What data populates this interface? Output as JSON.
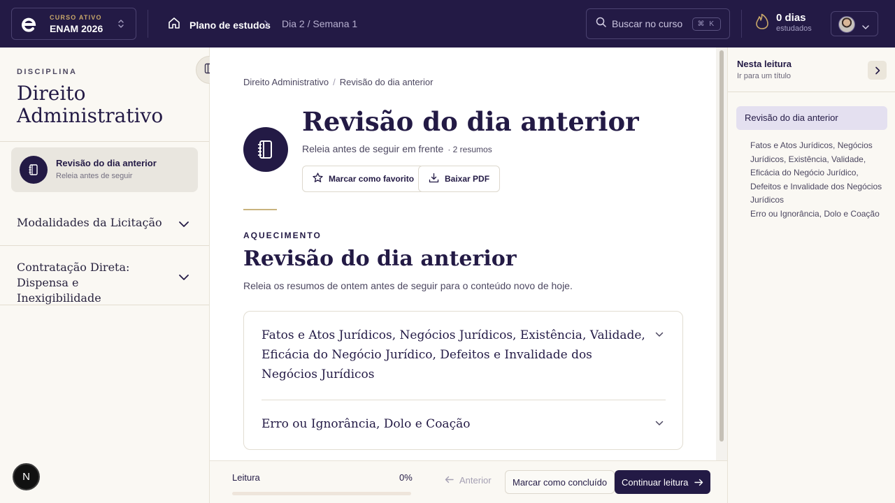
{
  "topbar": {
    "course_kicker": "CURSO ATIVO",
    "course_name": "ENAM 2026",
    "home_label": "Plano de estudos",
    "current_location": "Dia 2 / Semana 1",
    "search_placeholder": "Buscar no curso",
    "search_shortcut": "⌘ K",
    "streak_count": "0 dias",
    "streak_label": "estudados"
  },
  "sidebar": {
    "discipline_kicker": "DISCIPLINA",
    "discipline_title": "Direito Administrativo",
    "active_lesson": {
      "title": "Revisão do dia anterior",
      "subtitle": "Releia antes de seguir"
    },
    "modules": [
      {
        "label": "Modalidades da Licitação"
      },
      {
        "label": "Contratação Direta: Dispensa e Inexigibilidade"
      }
    ],
    "badge_letter": "N"
  },
  "main": {
    "breadcrumb": [
      "Direito Administrativo",
      "Revisão do dia anterior"
    ],
    "title": "Revisão do dia anterior",
    "subtitle": "Releia antes de seguir em frente",
    "summary_count": "· 2 resumos",
    "favorite_label": "Marcar como favorito",
    "pdf_label": "Baixar PDF",
    "section_kicker": "AQUECIMENTO",
    "section_title": "Revisão do dia anterior",
    "section_description": "Releia os resumos de ontem antes de seguir para o conteúdo novo de hoje.",
    "summaries": [
      {
        "title": "Fatos e Atos Jurídicos, Negócios Jurídicos, Existência, Validade, Eficácia do Negócio Jurídico, Defeitos e Invalidade dos Negócios Jurídicos"
      },
      {
        "title": "Erro ou Ignorância, Dolo e Coação"
      }
    ]
  },
  "footer": {
    "reading_label": "Leitura",
    "reading_percent": "0%",
    "reading_progress": 0,
    "previous_label": "Anterior",
    "mark_done_label": "Marcar como concluído",
    "continue_label": "Continuar leitura"
  },
  "toc": {
    "title": "Nesta leitura",
    "subtitle": "Ir para um título",
    "active_item": "Revisão do dia anterior",
    "items": [
      "Fatos e Atos Jurídicos, Negócios Jurídicos, Existência, Validade, Eficácia do Negócio Jurídico, Defeitos e Invalidade dos Negócios Jurídicos",
      "Erro ou Ignorância, Dolo e Coação"
    ]
  },
  "colors": {
    "brand_navy": "#231a45",
    "accent_gold": "#c9b37e",
    "toc_active_bg": "#e4e0f0"
  },
  "icons": [
    "logo-e-icon",
    "updown-icon",
    "home-icon",
    "chevron-right-icon",
    "search-icon",
    "flame-icon",
    "chevron-down-icon",
    "sidebar-collapse-icon",
    "notebook-icon",
    "star-icon",
    "download-icon",
    "arrow-left-icon",
    "arrow-right-icon"
  ]
}
